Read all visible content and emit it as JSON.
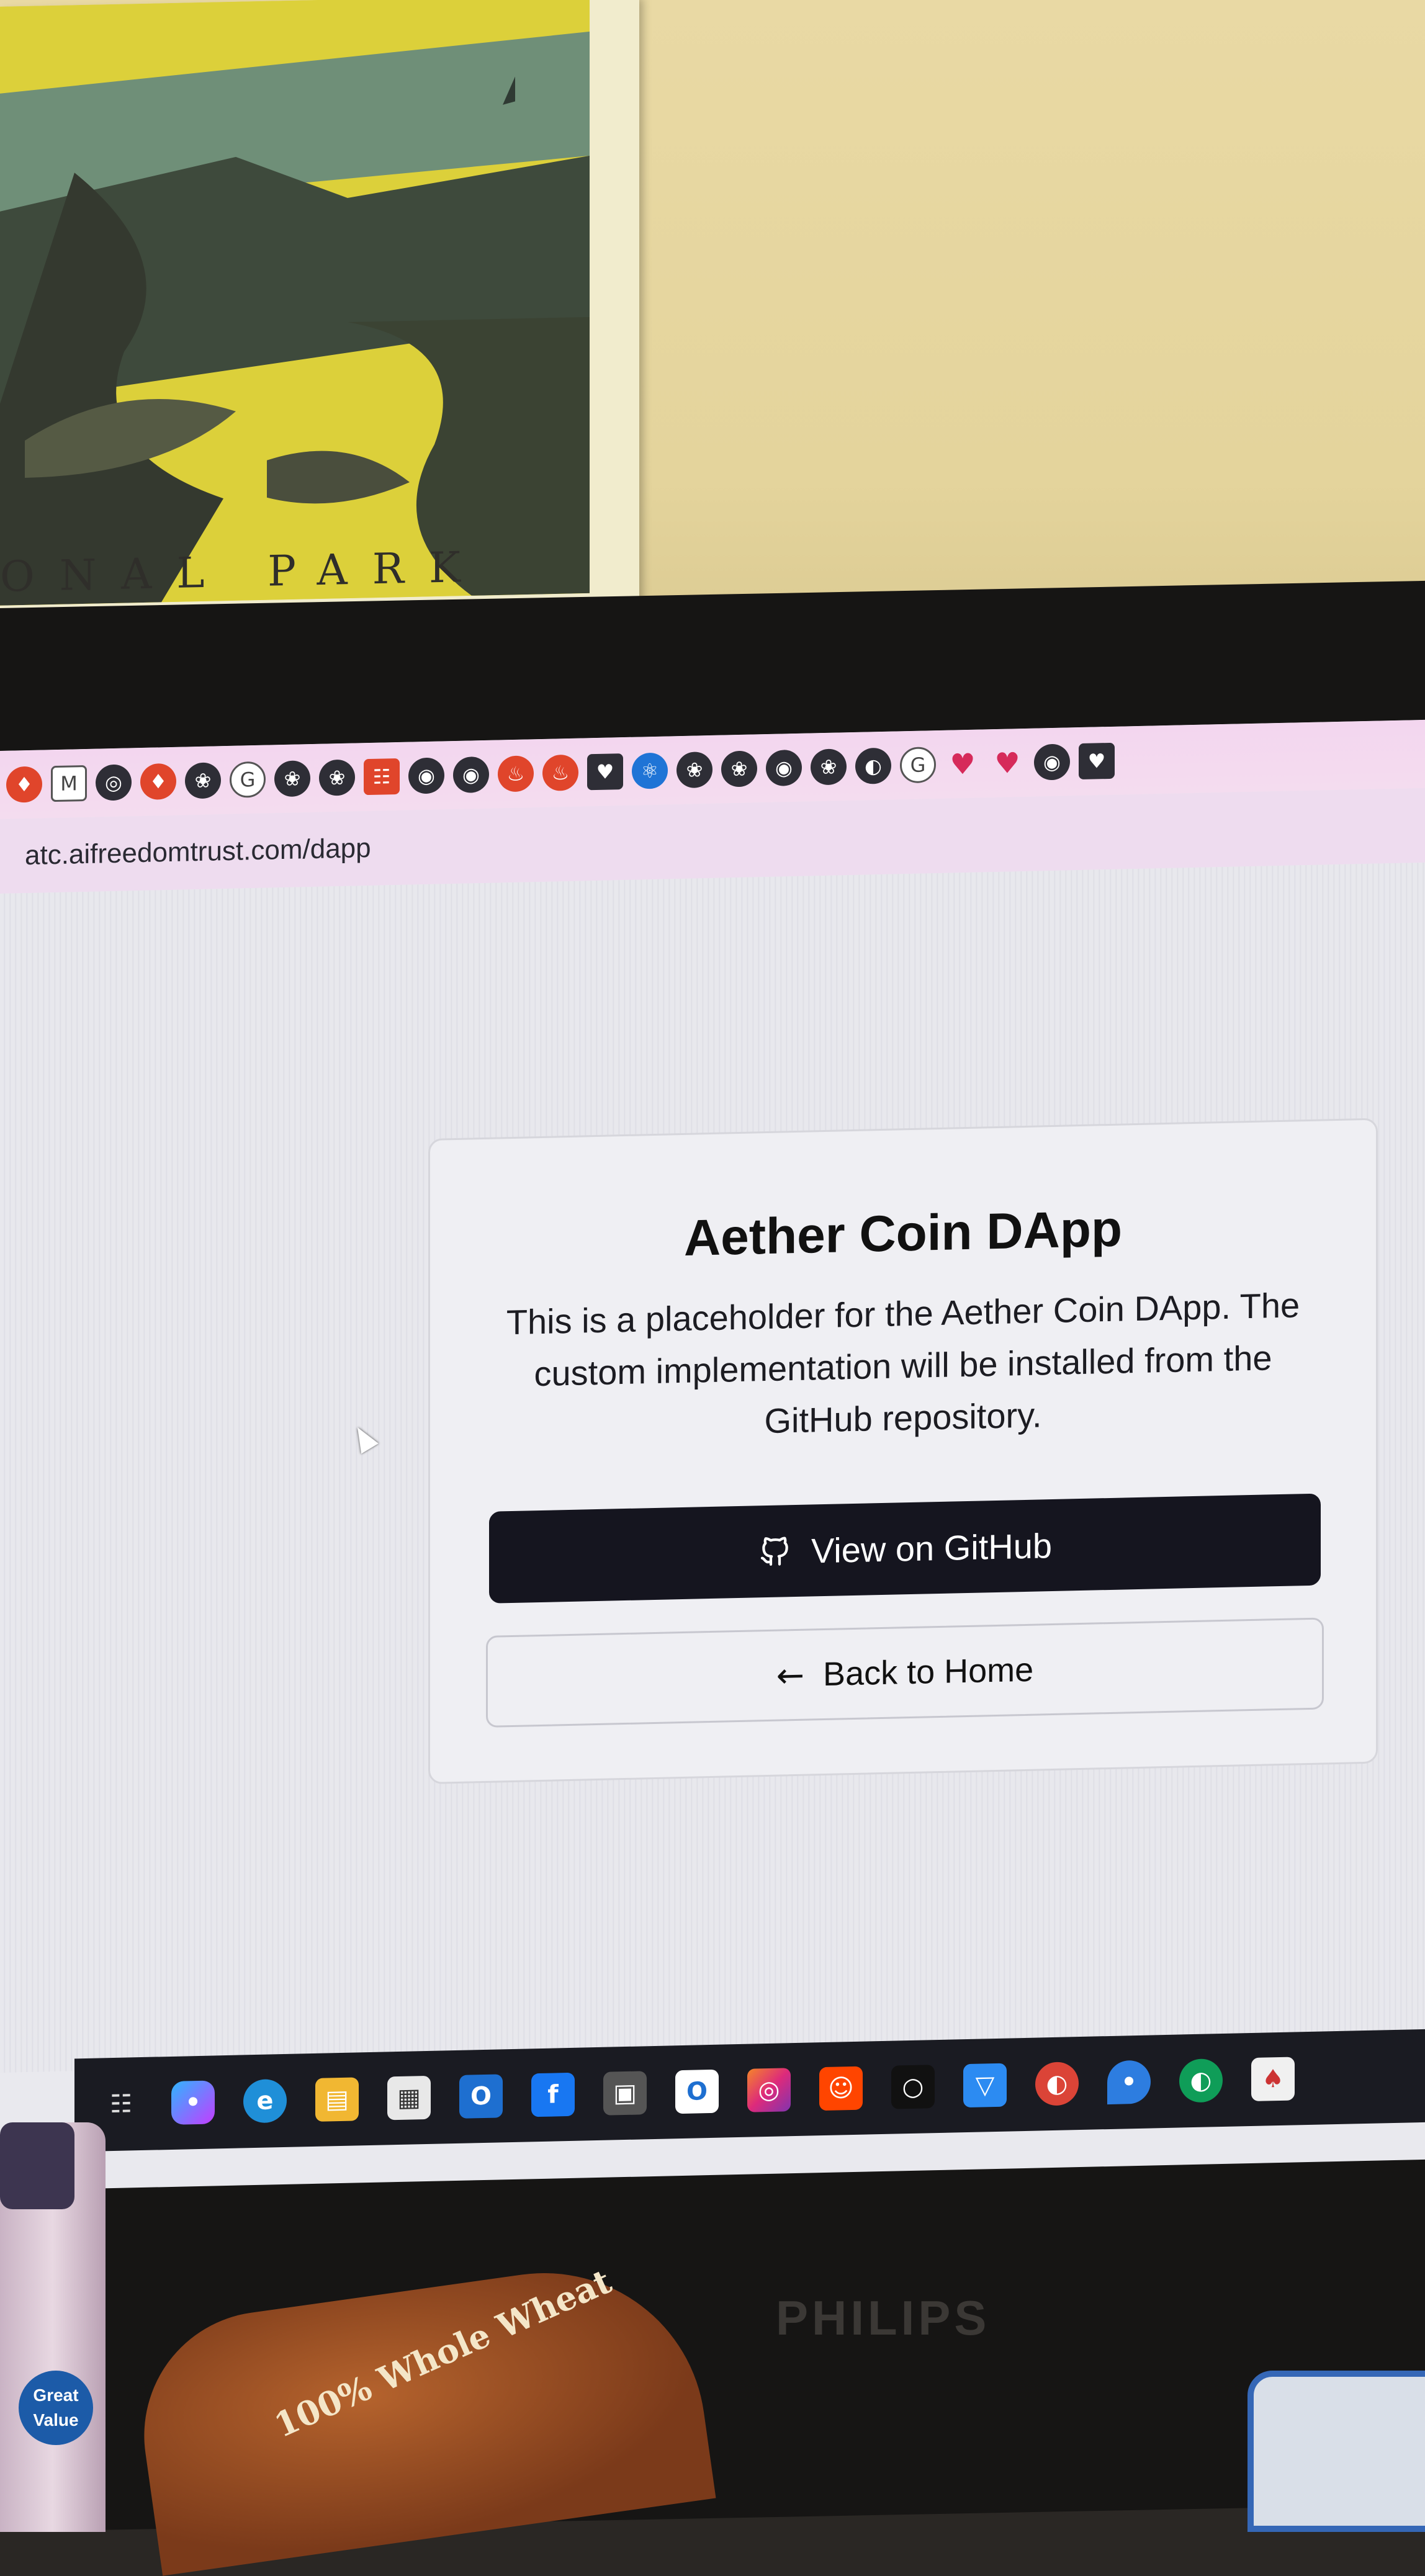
{
  "poster": {
    "caption": "ONAL PARK"
  },
  "browser": {
    "url": "atc.aifreedomtrust.com/dapp",
    "bookmarks": [
      "fox-icon",
      "gmail-icon",
      "globe-icon",
      "fox-icon",
      "openai-icon",
      "grammarly-icon",
      "openai-icon",
      "openai-icon",
      "grid-icon",
      "github-icon",
      "github-icon",
      "fire-icon",
      "fire-icon",
      "heart-box-icon",
      "react-icon",
      "openai-icon",
      "openai-icon",
      "github-icon",
      "openai-icon",
      "chrome-icon",
      "grammarly-icon",
      "heart-icon",
      "heart-icon",
      "github-icon",
      "heart-box-icon"
    ]
  },
  "card": {
    "title": "Aether Coin DApp",
    "description": "This is a placeholder for the Aether Coin DApp. The custom implementation will be installed from the GitHub repository.",
    "primary_button": "View on GitHub",
    "secondary_button": "Back to Home"
  },
  "taskbar": {
    "icons": [
      "task-view-icon",
      "copilot-icon",
      "edge-icon",
      "file-explorer-icon",
      "store-icon",
      "outlook-icon",
      "facebook-icon",
      "app-icon",
      "outlook-icon",
      "instagram-icon",
      "reddit-icon",
      "app-icon",
      "proton-icon",
      "chrome-icon",
      "maps-icon",
      "chrome-icon",
      "app-icon"
    ]
  },
  "monitor": {
    "brand": "PHILIPS"
  },
  "foreground": {
    "jar_label": "Great Value",
    "bread_text": "100% Whole Wheat"
  },
  "colors": {
    "card_button_primary": "#15151f",
    "wall": "#e6d69e",
    "poster_yellow": "#dfd23c",
    "address_bar": "#eedcef"
  }
}
